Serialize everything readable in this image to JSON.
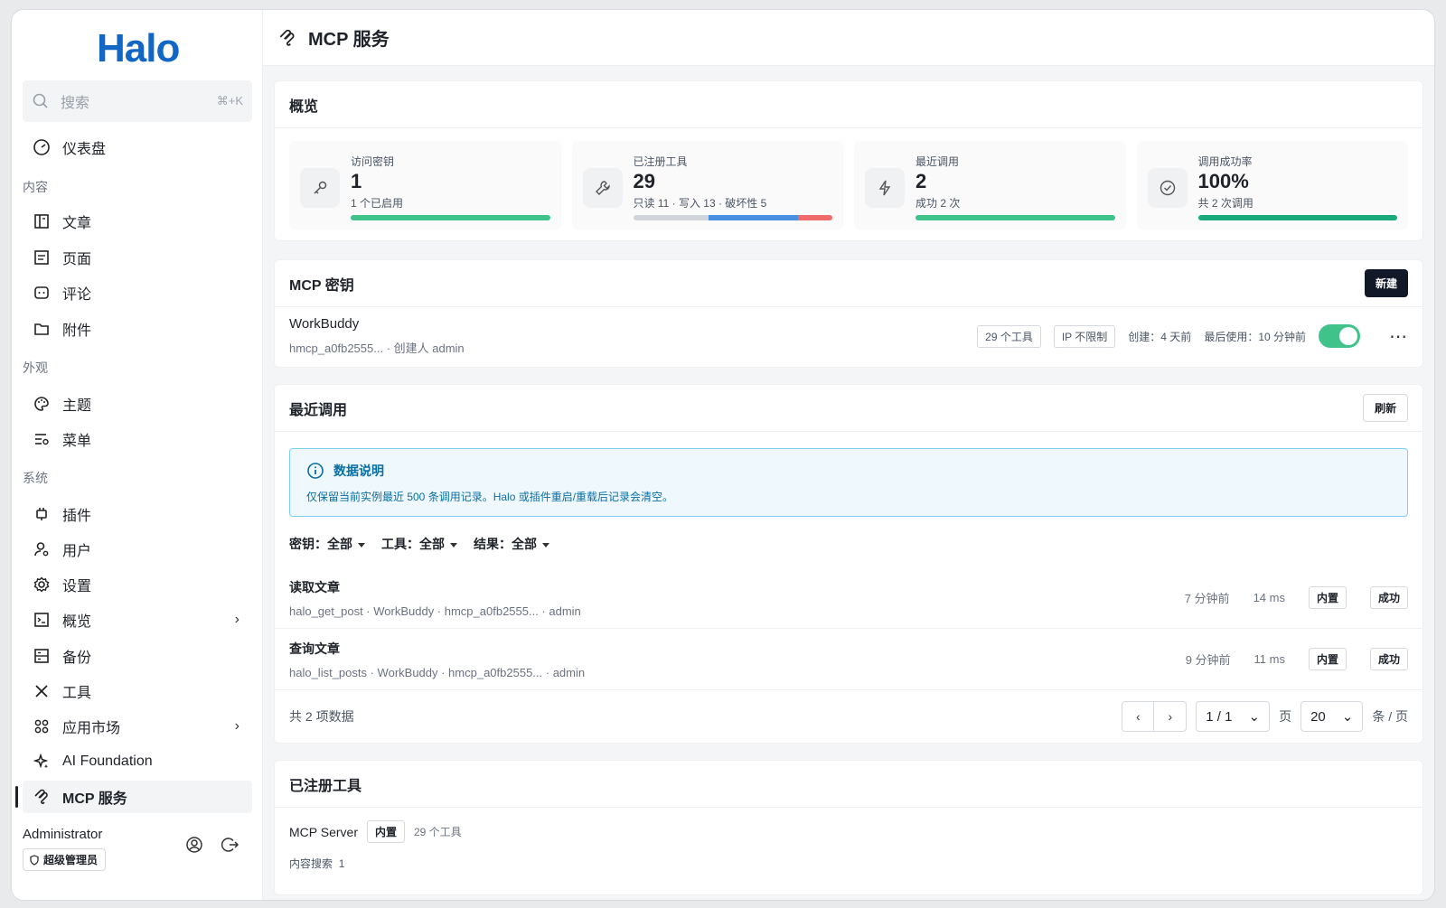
{
  "sidebar": {
    "logo": "Halo",
    "search": {
      "placeholder": "搜索",
      "shortcut": "⌘+K"
    },
    "dashboard": "仪表盘",
    "groups": {
      "content": "内容",
      "appearance": "外观",
      "system": "系统"
    },
    "items": {
      "posts": "文章",
      "pages": "页面",
      "comments": "评论",
      "attachments": "附件",
      "themes": "主题",
      "menus": "菜单",
      "plugins": "插件",
      "users": "用户",
      "settings": "设置",
      "overview": "概览",
      "backup": "备份",
      "tools": "工具",
      "market": "应用市场",
      "ai": "AI Foundation",
      "mcp": "MCP 服务"
    },
    "user": {
      "name": "Administrator",
      "role": "超级管理员"
    }
  },
  "header": {
    "title": "MCP 服务"
  },
  "overview": {
    "title": "概览",
    "stats": [
      {
        "label": "访问密钥",
        "value": "1",
        "sub": "1 个已启用",
        "percent": 100
      },
      {
        "label": "已注册工具",
        "value": "29",
        "sub": "只读 11 · 写入 13 · 破坏性 5",
        "segments": [
          11,
          13,
          5
        ]
      },
      {
        "label": "最近调用",
        "value": "2",
        "sub": "成功 2 次",
        "percent": 100
      },
      {
        "label": "调用成功率",
        "value": "100%",
        "sub": "共 2 次调用",
        "percent": 100
      }
    ]
  },
  "keys": {
    "title": "MCP 密钥",
    "new_label": "新建",
    "item": {
      "name": "WorkBuddy",
      "meta": "hmcp_a0fb2555... · 创建人 admin",
      "tools": "29 个工具",
      "ip": "IP 不限制",
      "created": "创建：4 天前",
      "last_used": "最后使用：10 分钟前",
      "enabled": true
    }
  },
  "calls": {
    "title": "最近调用",
    "refresh_label": "刷新",
    "notice": {
      "title": "数据说明",
      "text": "仅保留当前实例最近 500 条调用记录。Halo 或插件重启/重载后记录会清空。"
    },
    "filters": {
      "key": "密钥：全部",
      "tool": "工具：全部",
      "result": "结果：全部"
    },
    "rows": [
      {
        "title": "读取文章",
        "meta": "halo_get_post · WorkBuddy · hmcp_a0fb2555... · admin",
        "time": "7 分钟前",
        "duration": "14 ms",
        "source": "内置",
        "status": "成功"
      },
      {
        "title": "查询文章",
        "meta": "halo_list_posts · WorkBuddy · hmcp_a0fb2555... · admin",
        "time": "9 分钟前",
        "duration": "11 ms",
        "source": "内置",
        "status": "成功"
      }
    ],
    "pagination": {
      "total": "共 2 项数据",
      "page": "1 / 1",
      "page_unit": "页",
      "size": "20",
      "size_unit": "条 / 页"
    }
  },
  "tools": {
    "title": "已注册工具",
    "server": {
      "name": "MCP Server",
      "badge": "内置",
      "count": "29 个工具",
      "category": "内容搜索",
      "category_count": "1"
    }
  },
  "colors": {
    "green": "#3fc38a",
    "dark_green": "#19a97b",
    "blue": "#4a90e2",
    "red": "#ef6b6b",
    "gray": "#d1d5db",
    "brand": "#1266c4"
  }
}
